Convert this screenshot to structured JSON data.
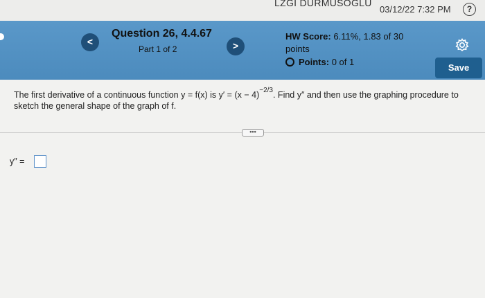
{
  "top_bar": {
    "username": "LZGI DURMUSOGLU",
    "datetime": "03/12/22 7:32 PM",
    "help_icon": "?"
  },
  "header": {
    "prev_label": "<",
    "next_label": ">",
    "question_title": "Question 26, 4.4.67",
    "question_part": "Part 1 of 2",
    "hw_score_label": "HW Score:",
    "hw_score_value": "6.11%, 1.83 of 30 points",
    "points_label": "Points:",
    "points_value": "0 of 1",
    "save_label": "Save"
  },
  "question": {
    "text_before": "The first derivative of a continuous function y = f(x) is y′ = (x − 4)",
    "exponent": "−2/3",
    "text_after": ". Find y″ and then use the graphing procedure to sketch the general shape of the graph of f.",
    "more_label": "•••"
  },
  "answer": {
    "label": "y″ ="
  },
  "colors": {
    "header_blue": "#5a98c9",
    "button_dark_blue": "#1f4f78",
    "save_blue": "#1f5f8f"
  },
  "icons": [
    "help-icon",
    "chevron-left-icon",
    "chevron-right-icon",
    "gear-icon",
    "circle-icon"
  ]
}
